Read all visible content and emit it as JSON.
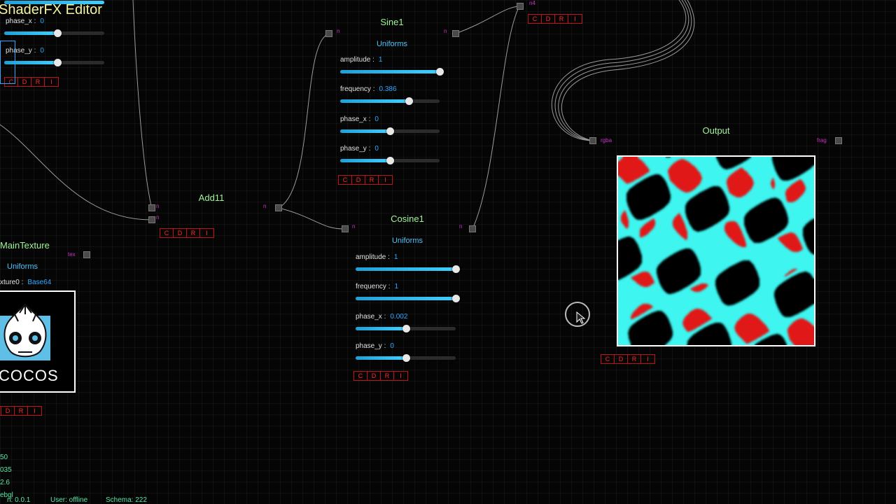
{
  "app": {
    "title": "ShaderFX Editor"
  },
  "status": {
    "left_values": [
      "50",
      "035",
      "2.6",
      "ebgl"
    ],
    "version": "n: 0.0.1",
    "user": "User: offline",
    "schema": "Schema: 222"
  },
  "cdri": [
    "C",
    "D",
    "R",
    "I"
  ],
  "top_left_node": {
    "params": [
      {
        "label": "phase_x :",
        "value": "0",
        "fraction": 0.53
      },
      {
        "label": "phase_y :",
        "value": "0",
        "fraction": 0.53
      }
    ]
  },
  "top_right_node": {
    "port_label": "n4"
  },
  "sine": {
    "title": "Sine1",
    "section": "Uniforms",
    "in_port": "n",
    "out_port": "n",
    "params": [
      {
        "label": "amplitude :",
        "value": "1",
        "fraction": 1.0
      },
      {
        "label": "frequency :",
        "value": "0.386",
        "fraction": 0.69
      },
      {
        "label": "phase_x :",
        "value": "0",
        "fraction": 0.5
      },
      {
        "label": "phase_y :",
        "value": "0",
        "fraction": 0.5
      }
    ]
  },
  "add": {
    "title": "Add11",
    "in_port_a": "n",
    "in_port_b": "n",
    "out_port": "n"
  },
  "cosine": {
    "title": "Cosine1",
    "section": "Uniforms",
    "in_port": "n",
    "out_port": "n",
    "params": [
      {
        "label": "amplitude :",
        "value": "1",
        "fraction": 1.0
      },
      {
        "label": "frequency :",
        "value": "1",
        "fraction": 1.0
      },
      {
        "label": "phase_x :",
        "value": "0.002",
        "fraction": 0.5
      },
      {
        "label": "phase_y :",
        "value": "0",
        "fraction": 0.5
      }
    ]
  },
  "main_texture": {
    "title": "MainTexture",
    "section": "Uniforms",
    "texture_label": "xture0 :",
    "texture_value": "Base64",
    "out_port": "tex",
    "logo_text": "COCOS"
  },
  "output": {
    "title": "Output",
    "in_port": "rgba",
    "out_port": "frag"
  },
  "colors": {
    "title_green": "#9ff598",
    "section_blue": "#4fc3f7",
    "value_blue": "#2ea8ff",
    "cdri_red": "#ff2a2a",
    "port_magenta": "#cc33cc",
    "pattern_cyan": "#3ef5f0",
    "pattern_red": "#e01818"
  }
}
